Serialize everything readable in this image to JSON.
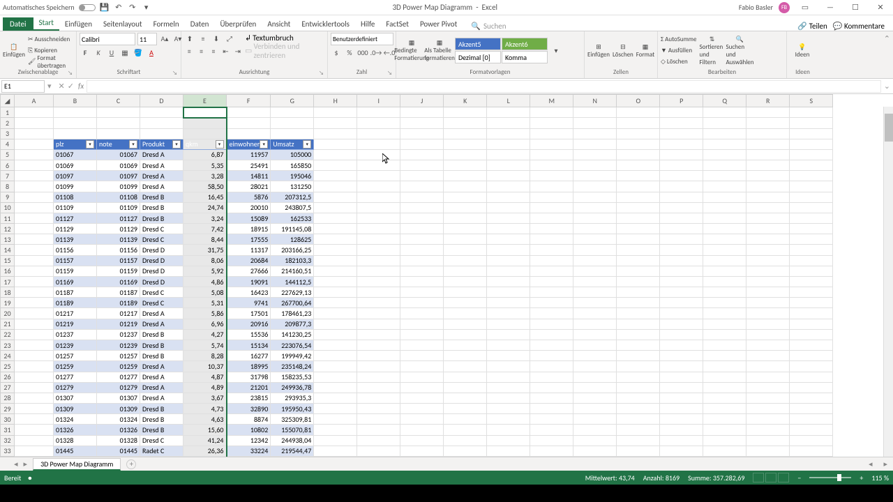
{
  "title_bar": {
    "autosave": "Automatisches Speichern",
    "doc": "3D Power Map Diagramm",
    "app": "Excel",
    "user": "Fabio Basler",
    "initials": "FB"
  },
  "ribbon": {
    "file": "Datei",
    "tabs": [
      "Start",
      "Einfügen",
      "Seitenlayout",
      "Formeln",
      "Daten",
      "Überprüfen",
      "Ansicht",
      "Entwicklertools",
      "Hilfe",
      "FactSet",
      "Power Pivot"
    ],
    "search": "Suchen",
    "share": "Teilen",
    "comments": "Kommentare",
    "clipboard": {
      "paste": "Einfügen",
      "cut": "Ausschneiden",
      "copy": "Kopieren",
      "format": "Format übertragen",
      "label": "Zwischenablage"
    },
    "font": {
      "name": "Calibri",
      "size": "11",
      "label": "Schriftart"
    },
    "align": {
      "wrap": "Textumbruch",
      "merge": "Verbinden und zentrieren",
      "label": "Ausrichtung"
    },
    "number": {
      "format": "Benutzerdefiniert",
      "label": "Zahl"
    },
    "styles": {
      "cond": "Bedingte Formatierung",
      "table": "Als Tabelle formatieren",
      "accent5": "Akzent5",
      "accent6": "Akzent6",
      "dezimal": "Dezimal [0]",
      "komma": "Komma",
      "label": "Formatvorlagen"
    },
    "cells": {
      "insert": "Einfügen",
      "delete": "Löschen",
      "format": "Format",
      "label": "Zellen"
    },
    "editing": {
      "sum": "AutoSumme",
      "fill": "Ausfüllen",
      "clear": "Löschen",
      "sort": "Sortieren und Filtern",
      "find": "Suchen und Auswählen",
      "label": "Bearbeiten"
    },
    "ideas": {
      "label": "Ideen"
    }
  },
  "name_box": "E1",
  "columns": [
    "A",
    "B",
    "C",
    "D",
    "E",
    "F",
    "G",
    "H",
    "I",
    "J",
    "K",
    "L",
    "M",
    "N",
    "O",
    "P",
    "Q",
    "R",
    "S"
  ],
  "table_headers": {
    "col_b": "plz",
    "col_c": "note",
    "col_d": "Produkt",
    "col_e": "qkm",
    "col_f": "einwohner",
    "col_g": "Umsatz"
  },
  "rows": [
    {
      "r": 5,
      "plz": "01067",
      "note": "01067",
      "prod": "Dresd A",
      "qkm": "6,87",
      "ein": "11957",
      "um": "105000"
    },
    {
      "r": 6,
      "plz": "01069",
      "note": "01069",
      "prod": "Dresd A",
      "qkm": "5,35",
      "ein": "25491",
      "um": "165850"
    },
    {
      "r": 7,
      "plz": "01097",
      "note": "01097",
      "prod": "Dresd A",
      "qkm": "3,28",
      "ein": "14811",
      "um": "195046"
    },
    {
      "r": 8,
      "plz": "01099",
      "note": "01099",
      "prod": "Dresd A",
      "qkm": "58,50",
      "ein": "28021",
      "um": "131250"
    },
    {
      "r": 9,
      "plz": "01108",
      "note": "01108",
      "prod": "Dresd B",
      "qkm": "16,45",
      "ein": "5876",
      "um": "207312,5"
    },
    {
      "r": 10,
      "plz": "01109",
      "note": "01109",
      "prod": "Dresd B",
      "qkm": "24,74",
      "ein": "20010",
      "um": "243807,5"
    },
    {
      "r": 11,
      "plz": "01127",
      "note": "01127",
      "prod": "Dresd B",
      "qkm": "3,24",
      "ein": "15089",
      "um": "162533"
    },
    {
      "r": 12,
      "plz": "01129",
      "note": "01129",
      "prod": "Dresd C",
      "qkm": "7,42",
      "ein": "18915",
      "um": "191145,08"
    },
    {
      "r": 13,
      "plz": "01139",
      "note": "01139",
      "prod": "Dresd C",
      "qkm": "8,44",
      "ein": "17555",
      "um": "128625"
    },
    {
      "r": 14,
      "plz": "01156",
      "note": "01156",
      "prod": "Dresd D",
      "qkm": "31,75",
      "ein": "11317",
      "um": "203166,25"
    },
    {
      "r": 15,
      "plz": "01157",
      "note": "01157",
      "prod": "Dresd D",
      "qkm": "8,06",
      "ein": "20684",
      "um": "182103,3"
    },
    {
      "r": 16,
      "plz": "01159",
      "note": "01159",
      "prod": "Dresd D",
      "qkm": "5,92",
      "ein": "27666",
      "um": "214160,51"
    },
    {
      "r": 17,
      "plz": "01169",
      "note": "01169",
      "prod": "Dresd D",
      "qkm": "4,86",
      "ein": "19091",
      "um": "144112,5"
    },
    {
      "r": 18,
      "plz": "01187",
      "note": "01187",
      "prod": "Dresd C",
      "qkm": "5,08",
      "ein": "16423",
      "um": "227629,13"
    },
    {
      "r": 19,
      "plz": "01189",
      "note": "01189",
      "prod": "Dresd C",
      "qkm": "5,31",
      "ein": "9741",
      "um": "267700,64"
    },
    {
      "r": 20,
      "plz": "01217",
      "note": "01217",
      "prod": "Dresd A",
      "qkm": "5,86",
      "ein": "17501",
      "um": "178461,23"
    },
    {
      "r": 21,
      "plz": "01219",
      "note": "01219",
      "prod": "Dresd A",
      "qkm": "6,96",
      "ein": "20916",
      "um": "209877,3"
    },
    {
      "r": 22,
      "plz": "01237",
      "note": "01237",
      "prod": "Dresd B",
      "qkm": "4,27",
      "ein": "15536",
      "um": "141230,25"
    },
    {
      "r": 23,
      "plz": "01239",
      "note": "01239",
      "prod": "Dresd B",
      "qkm": "5,74",
      "ein": "15134",
      "um": "223076,54"
    },
    {
      "r": 24,
      "plz": "01257",
      "note": "01257",
      "prod": "Dresd B",
      "qkm": "8,28",
      "ein": "16277",
      "um": "199949,42"
    },
    {
      "r": 25,
      "plz": "01259",
      "note": "01259",
      "prod": "Dresd A",
      "qkm": "10,37",
      "ein": "18995",
      "um": "235148,24"
    },
    {
      "r": 26,
      "plz": "01277",
      "note": "01277",
      "prod": "Dresd A",
      "qkm": "4,87",
      "ein": "31798",
      "um": "158235,53"
    },
    {
      "r": 27,
      "plz": "01279",
      "note": "01279",
      "prod": "Dresd A",
      "qkm": "4,89",
      "ein": "21201",
      "um": "249936,78"
    },
    {
      "r": 28,
      "plz": "01307",
      "note": "01307",
      "prod": "Dresd A",
      "qkm": "3,67",
      "ein": "23815",
      "um": "293935,3"
    },
    {
      "r": 29,
      "plz": "01309",
      "note": "01309",
      "prod": "Dresd B",
      "qkm": "4,73",
      "ein": "32890",
      "um": "195950,43"
    },
    {
      "r": 30,
      "plz": "01324",
      "note": "01324",
      "prod": "Dresd B",
      "qkm": "4,63",
      "ein": "8874",
      "um": "325309,81"
    },
    {
      "r": 31,
      "plz": "01326",
      "note": "01326",
      "prod": "Dresd B",
      "qkm": "15,60",
      "ein": "10802",
      "um": "155070,81"
    },
    {
      "r": 32,
      "plz": "01328",
      "note": "01328",
      "prod": "Dresd C",
      "qkm": "41,24",
      "ein": "12342",
      "um": "244938,04"
    },
    {
      "r": 33,
      "plz": "01445",
      "note": "01445",
      "prod": "Radet C",
      "qkm": "26,36",
      "ein": "33224",
      "um": "219544,47"
    }
  ],
  "sheet_tab": "3D Power Map Diagramm",
  "status": {
    "ready": "Bereit",
    "avg": "Mittelwert: 43,74",
    "count": "Anzahl: 8169",
    "sum": "Summe: 357.282,69",
    "zoom": "115 %"
  }
}
